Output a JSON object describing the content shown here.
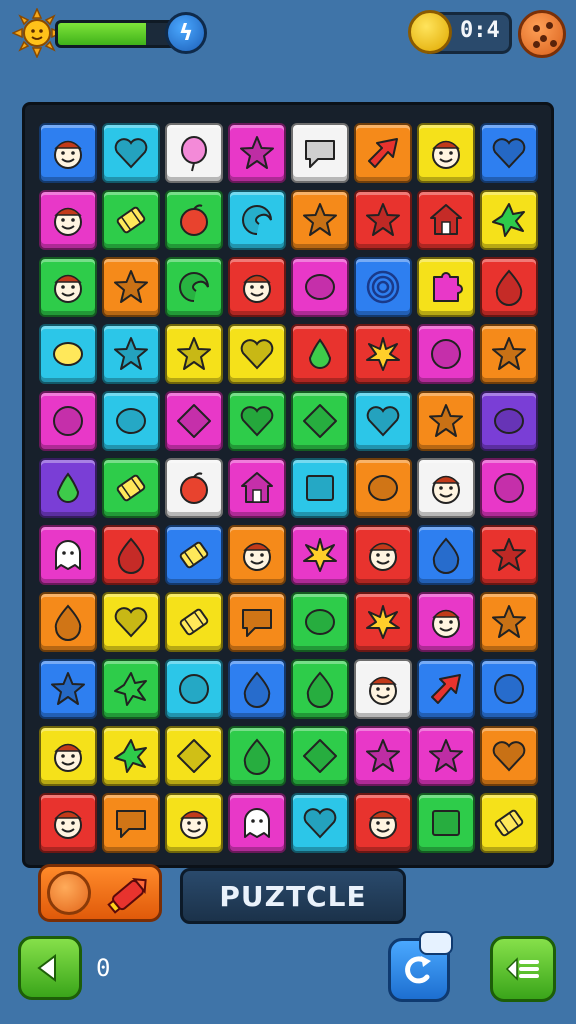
{
  "header": {
    "energy_level": 0.72,
    "timer_text": "0:4",
    "colors": {
      "energy": "#5ccb2a",
      "coin": "#f5c518"
    }
  },
  "board": {
    "rows": 11,
    "cols": 8,
    "tiles": [
      [
        [
          "#2e7ff0",
          "face"
        ],
        [
          "#2cc6e8",
          "heart"
        ],
        [
          "#f4f4f4",
          "balloon"
        ],
        [
          "#e838c8",
          "star"
        ],
        [
          "#f4f4f4",
          "bubble"
        ],
        [
          "#f58a1a",
          "arrow"
        ],
        [
          "#f5e11a",
          "face"
        ],
        [
          "#2e7ff0",
          "heart"
        ]
      ],
      [
        [
          "#e838c8",
          "face"
        ],
        [
          "#2ecc4a",
          "candy"
        ],
        [
          "#2ecc4a",
          "apple"
        ],
        [
          "#2cc6e8",
          "swirl"
        ],
        [
          "#f58a1a",
          "star"
        ],
        [
          "#e8332e",
          "star"
        ],
        [
          "#e8332e",
          "house"
        ],
        [
          "#f5e11a",
          "splat"
        ]
      ],
      [
        [
          "#2ecc4a",
          "face"
        ],
        [
          "#f58a1a",
          "star"
        ],
        [
          "#2ecc4a",
          "swirl"
        ],
        [
          "#e8332e",
          "face"
        ],
        [
          "#e838c8",
          "blob"
        ],
        [
          "#2e7ff0",
          "target"
        ],
        [
          "#f5e11a",
          "puzzle"
        ],
        [
          "#e8332e",
          "drop"
        ]
      ],
      [
        [
          "#2cc6e8",
          "lemon"
        ],
        [
          "#2cc6e8",
          "star"
        ],
        [
          "#f5e11a",
          "star"
        ],
        [
          "#f5e11a",
          "heart"
        ],
        [
          "#e8332e",
          "pear"
        ],
        [
          "#e8332e",
          "leaf"
        ],
        [
          "#e838c8",
          "circle"
        ],
        [
          "#f58a1a",
          "star"
        ]
      ],
      [
        [
          "#e838c8",
          "circle"
        ],
        [
          "#2cc6e8",
          "blob"
        ],
        [
          "#e838c8",
          "diamond"
        ],
        [
          "#2ecc4a",
          "heart"
        ],
        [
          "#2ecc4a",
          "diamond"
        ],
        [
          "#2cc6e8",
          "heart"
        ],
        [
          "#f58a1a",
          "star"
        ],
        [
          "#7a3ed6",
          "blob"
        ]
      ],
      [
        [
          "#7a3ed6",
          "pear"
        ],
        [
          "#2ecc4a",
          "candy"
        ],
        [
          "#f4f4f4",
          "apple"
        ],
        [
          "#e838c8",
          "house"
        ],
        [
          "#2cc6e8",
          "square"
        ],
        [
          "#f58a1a",
          "blob"
        ],
        [
          "#f4f4f4",
          "face"
        ],
        [
          "#e838c8",
          "circle"
        ]
      ],
      [
        [
          "#e838c8",
          "ghost"
        ],
        [
          "#e8332e",
          "drop"
        ],
        [
          "#2e7ff0",
          "candy"
        ],
        [
          "#f58a1a",
          "face"
        ],
        [
          "#e838c8",
          "leaf"
        ],
        [
          "#e8332e",
          "face"
        ],
        [
          "#2e7ff0",
          "drop"
        ],
        [
          "#e8332e",
          "star"
        ]
      ],
      [
        [
          "#f58a1a",
          "drop"
        ],
        [
          "#f5e11a",
          "heart"
        ],
        [
          "#f5e11a",
          "candy"
        ],
        [
          "#f58a1a",
          "bubble"
        ],
        [
          "#2ecc4a",
          "blob"
        ],
        [
          "#e8332e",
          "leaf"
        ],
        [
          "#e838c8",
          "face"
        ],
        [
          "#f58a1a",
          "star"
        ]
      ],
      [
        [
          "#2e7ff0",
          "star"
        ],
        [
          "#2ecc4a",
          "splat"
        ],
        [
          "#2cc6e8",
          "circle"
        ],
        [
          "#2e7ff0",
          "drop"
        ],
        [
          "#2ecc4a",
          "drop"
        ],
        [
          "#f4f4f4",
          "face"
        ],
        [
          "#2e7ff0",
          "arrow"
        ],
        [
          "#2e7ff0",
          "circle"
        ]
      ],
      [
        [
          "#f5e11a",
          "face"
        ],
        [
          "#f5e11a",
          "splat"
        ],
        [
          "#f5e11a",
          "diamond"
        ],
        [
          "#2ecc4a",
          "drop"
        ],
        [
          "#2ecc4a",
          "diamond"
        ],
        [
          "#e838c8",
          "star"
        ],
        [
          "#e838c8",
          "star"
        ],
        [
          "#f58a1a",
          "heart"
        ]
      ],
      [
        [
          "#e8332e",
          "face"
        ],
        [
          "#f58a1a",
          "bubble"
        ],
        [
          "#f5e11a",
          "face"
        ],
        [
          "#e838c8",
          "ghost"
        ],
        [
          "#2cc6e8",
          "heart"
        ],
        [
          "#e8332e",
          "face"
        ],
        [
          "#2ecc4a",
          "square"
        ],
        [
          "#f5e11a",
          "candy"
        ]
      ]
    ]
  },
  "footer": {
    "title": "PUZTCLE",
    "score": "0"
  }
}
